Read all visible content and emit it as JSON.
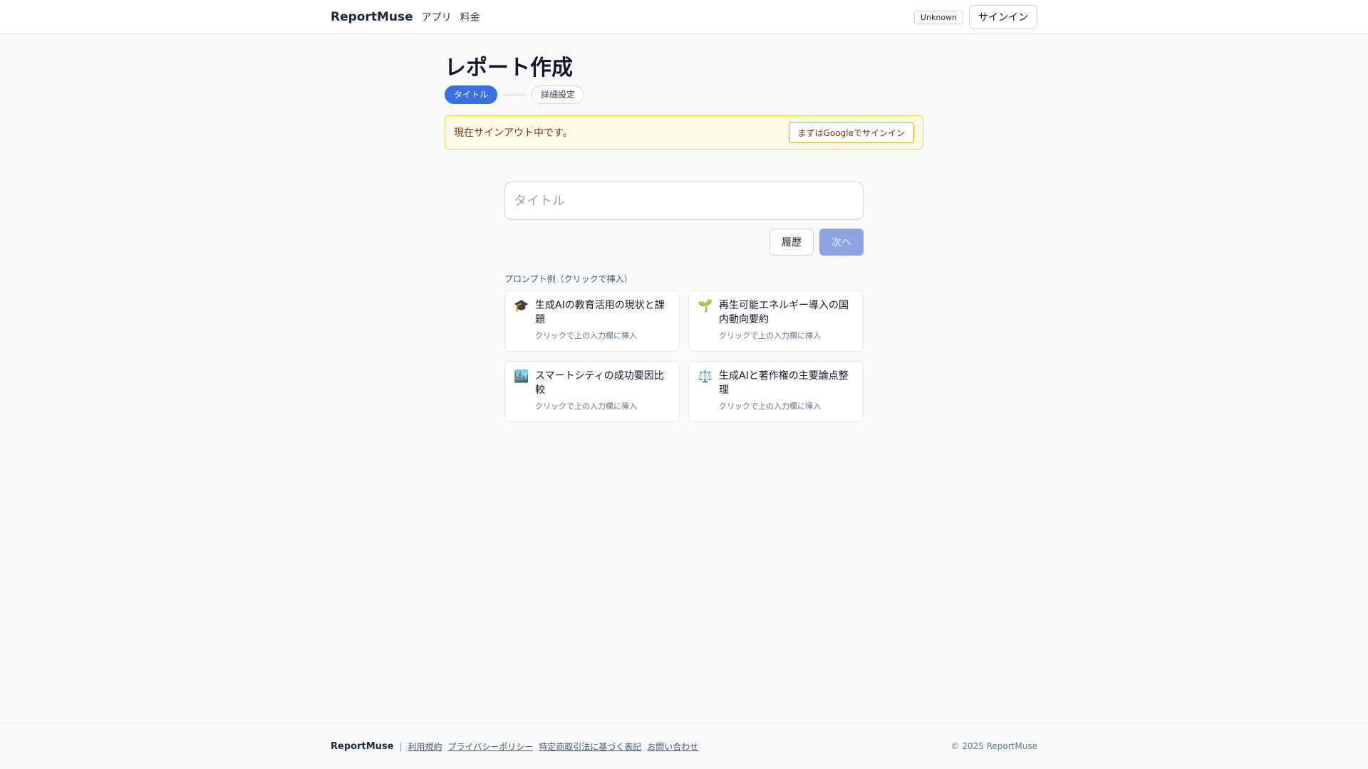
{
  "header": {
    "brand": "ReportMuse",
    "nav": [
      "アプリ",
      "料金"
    ],
    "badge": "Unknown",
    "signin": "サインイン"
  },
  "main": {
    "title": "レポート作成",
    "steps": [
      "タイトル",
      "詳細設定"
    ],
    "alert": {
      "text": "現在サインアウト中です。",
      "button": "まずはGoogleでサインイン"
    },
    "input": {
      "placeholder": "タイトル",
      "value": ""
    },
    "buttons": {
      "history": "履歴",
      "next": "次へ"
    },
    "examples_label": "プロンプト例（クリックで挿入）",
    "examples": [
      {
        "icon": "🎓",
        "title": "生成AIの教育活用の現状と課題",
        "sub": "クリックで上の入力欄に挿入"
      },
      {
        "icon": "🌱",
        "title": "再生可能エネルギー導入の国内動向要約",
        "sub": "クリックで上の入力欄に挿入"
      },
      {
        "icon": "🏙️",
        "title": "スマートシティの成功要因比較",
        "sub": "クリックで上の入力欄に挿入"
      },
      {
        "icon": "⚖️",
        "title": "生成AIと著作権の主要論点整理",
        "sub": "クリックで上の入力欄に挿入"
      }
    ]
  },
  "footer": {
    "brand": "ReportMuse",
    "links": [
      "利用規約",
      "プライバシーポリシー",
      "特定商取引法に基づく表記",
      "お問い合わせ"
    ],
    "copyright": "© 2025 ReportMuse"
  }
}
